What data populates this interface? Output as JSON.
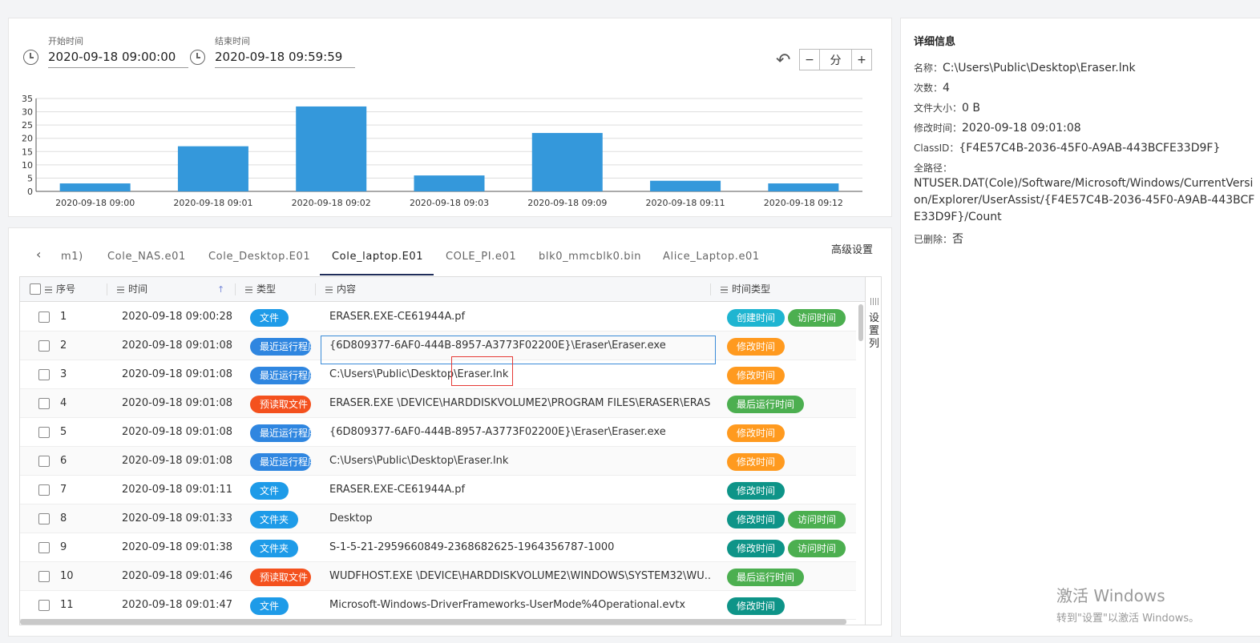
{
  "time_range": {
    "start_label": "开始时间",
    "start_value": "2020-09-18 09:00:00",
    "end_label": "结束时间",
    "end_value": "2020-09-18 09:59:59"
  },
  "zoom": {
    "minus": "−",
    "unit": "分",
    "plus": "+"
  },
  "chart_data": {
    "type": "bar",
    "categories": [
      "2020-09-18 09:00",
      "2020-09-18 09:01",
      "2020-09-18 09:02",
      "2020-09-18 09:03",
      "2020-09-18 09:09",
      "2020-09-18 09:11",
      "2020-09-18 09:12"
    ],
    "values": [
      3,
      17,
      32,
      6,
      22,
      4,
      3
    ],
    "yticks": [
      0,
      5,
      10,
      15,
      20,
      25,
      30,
      35
    ],
    "ylim": [
      0,
      35
    ],
    "color": "#3498db",
    "grid": true
  },
  "tabs": [
    {
      "label": "m1)"
    },
    {
      "label": "Cole_NAS.e01"
    },
    {
      "label": "Cole_Desktop.E01"
    },
    {
      "label": "Cole_laptop.E01"
    },
    {
      "label": "COLE_PI.e01"
    },
    {
      "label": "blk0_mmcblk0.bin"
    },
    {
      "label": "Alice_Laptop.e01"
    }
  ],
  "active_tab": "Cole_laptop.E01",
  "advanced_settings": "高级设置",
  "columns": {
    "seq": "序号",
    "time": "时间",
    "type": "类型",
    "content": "内容",
    "time_type": "时间类型"
  },
  "set_columns": "设置列",
  "colors": {
    "file": "#1e9be8",
    "recent": "#2f86e0",
    "prefetch": "#f4511e",
    "create": "#1fb5d1",
    "access": "#4caf50",
    "modify": "#ff9a1f",
    "modify_teal": "#0e9488",
    "last_run": "#4caf50"
  },
  "rows": [
    {
      "seq": "1",
      "time": "2020-09-18 09:00:28",
      "type": "文件",
      "type_color": "#1e9be8",
      "content": "ERASER.EXE-CE61944A.pf",
      "badges": [
        {
          "label": "创建时间",
          "color": "#1fb5d1"
        },
        {
          "label": "访问时间",
          "color": "#4caf50"
        }
      ]
    },
    {
      "seq": "2",
      "time": "2020-09-18 09:01:08",
      "type": "最近运行程序",
      "type_color": "#2f86e0",
      "content": "{6D809377-6AF0-444B-8957-A3773F02200E}\\Eraser\\Eraser.exe",
      "badges": [
        {
          "label": "修改时间",
          "color": "#ff9a1f"
        }
      ]
    },
    {
      "seq": "3",
      "time": "2020-09-18 09:01:08",
      "type": "最近运行程序",
      "type_color": "#2f86e0",
      "content": "C:\\Users\\Public\\Desktop\\Eraser.lnk",
      "badges": [
        {
          "label": "修改时间",
          "color": "#ff9a1f"
        }
      ]
    },
    {
      "seq": "4",
      "time": "2020-09-18 09:01:08",
      "type": "预读取文件",
      "type_color": "#f4511e",
      "content": "ERASER.EXE \\DEVICE\\HARDDISKVOLUME2\\PROGRAM FILES\\ERASER\\ERAS...",
      "badges": [
        {
          "label": "最后运行时间",
          "color": "#4caf50"
        }
      ]
    },
    {
      "seq": "5",
      "time": "2020-09-18 09:01:08",
      "type": "最近运行程序",
      "type_color": "#2f86e0",
      "content": "{6D809377-6AF0-444B-8957-A3773F02200E}\\Eraser\\Eraser.exe",
      "badges": [
        {
          "label": "修改时间",
          "color": "#ff9a1f"
        }
      ]
    },
    {
      "seq": "6",
      "time": "2020-09-18 09:01:08",
      "type": "最近运行程序",
      "type_color": "#2f86e0",
      "content": "C:\\Users\\Public\\Desktop\\Eraser.lnk",
      "badges": [
        {
          "label": "修改时间",
          "color": "#ff9a1f"
        }
      ]
    },
    {
      "seq": "7",
      "time": "2020-09-18 09:01:11",
      "type": "文件",
      "type_color": "#1e9be8",
      "content": "ERASER.EXE-CE61944A.pf",
      "badges": [
        {
          "label": "修改时间",
          "color": "#0e9488"
        }
      ]
    },
    {
      "seq": "8",
      "time": "2020-09-18 09:01:33",
      "type": "文件夹",
      "type_color": "#1e9be8",
      "content": "Desktop",
      "badges": [
        {
          "label": "修改时间",
          "color": "#0e9488"
        },
        {
          "label": "访问时间",
          "color": "#4caf50"
        }
      ]
    },
    {
      "seq": "9",
      "time": "2020-09-18 09:01:38",
      "type": "文件夹",
      "type_color": "#1e9be8",
      "content": "S-1-5-21-2959660849-2368682625-1964356787-1000",
      "badges": [
        {
          "label": "修改时间",
          "color": "#0e9488"
        },
        {
          "label": "访问时间",
          "color": "#4caf50"
        }
      ]
    },
    {
      "seq": "10",
      "time": "2020-09-18 09:01:46",
      "type": "预读取文件",
      "type_color": "#f4511e",
      "content": "WUDFHOST.EXE \\DEVICE\\HARDDISKVOLUME2\\WINDOWS\\SYSTEM32\\WU...",
      "badges": [
        {
          "label": "最后运行时间",
          "color": "#4caf50"
        }
      ]
    },
    {
      "seq": "11",
      "time": "2020-09-18 09:01:47",
      "type": "文件",
      "type_color": "#1e9be8",
      "content": "Microsoft-Windows-DriverFrameworks-UserMode%4Operational.evtx",
      "badges": [
        {
          "label": "修改时间",
          "color": "#0e9488"
        }
      ]
    }
  ],
  "detail": {
    "title": "详细信息",
    "name_label": "名称：",
    "name_value": "C:\\Users\\Public\\Desktop\\Eraser.lnk",
    "count_label": "次数：",
    "count_value": "4",
    "size_label": "文件大小：",
    "size_value": "0 B",
    "mtime_label": "修改时间：",
    "mtime_value": "2020-09-18 09:01:08",
    "classid_label": "ClassID：",
    "classid_value": "{F4E57C4B-2036-45F0-A9AB-443BCFE33D9F}",
    "path_label": "全路径：",
    "path_value": "NTUSER.DAT(Cole)/Software/Microsoft/Windows/CurrentVersion/Explorer/UserAssist/{F4E57C4B-2036-45F0-A9AB-443BCFE33D9F}/Count",
    "deleted_label": "已删除：",
    "deleted_value": "否"
  },
  "watermark": {
    "line1": "激活 Windows",
    "line2": "转到\"设置\"以激活 Windows。"
  }
}
